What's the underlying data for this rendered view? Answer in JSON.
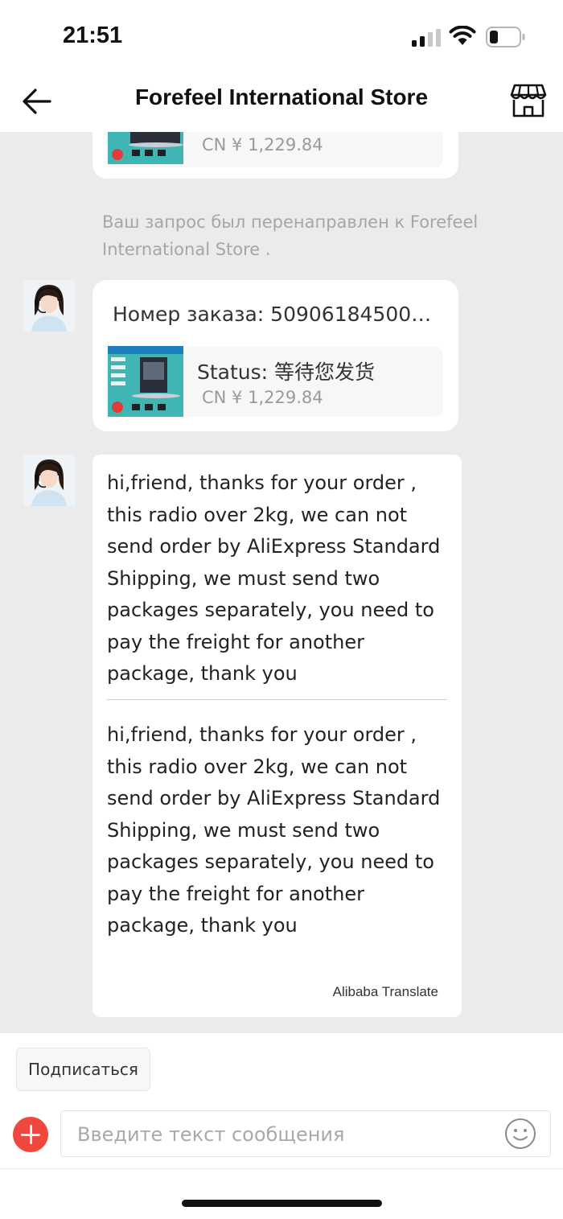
{
  "status_bar": {
    "time": "21:51",
    "icons": [
      "signal-icon",
      "wifi-icon",
      "battery-icon"
    ]
  },
  "header": {
    "title": "Forefeel International Store",
    "back_icon": "arrow-left-icon",
    "store_icon": "store-icon"
  },
  "messages": {
    "product_top": {
      "price": "CN ¥  1,229.84"
    },
    "system": "Ваш запрос был перенаправлен к Forefeel International Store .",
    "order_card": {
      "order_number": "Номер заказа: 5090618450070...",
      "status": "Status:  等待您发货",
      "price": "CN ¥  1,229.84"
    },
    "seller_message": {
      "original": "hi,friend, thanks for your order , this radio over 2kg, we can not send order by AliExpress Standard Shipping, we must send two packages separately, you need to pay the freight for another package, thank you",
      "translated": "hi,friend, thanks for your order , this radio over 2kg, we can not send order by AliExpress Standard Shipping, we must send two packages separately, you need to pay the freight for another package, thank you",
      "translator": "Alibaba Translate"
    }
  },
  "composer": {
    "subscribe_label": "Подписаться",
    "placeholder": "Введите текст сообщения",
    "plus_icon": "plus-circle-icon",
    "emoji_icon": "smiley-icon"
  },
  "colors": {
    "accent": "#f0473f",
    "chat_background": "#ebebeb",
    "bubble": "#ffffff",
    "system_text": "#a6a6a6"
  }
}
